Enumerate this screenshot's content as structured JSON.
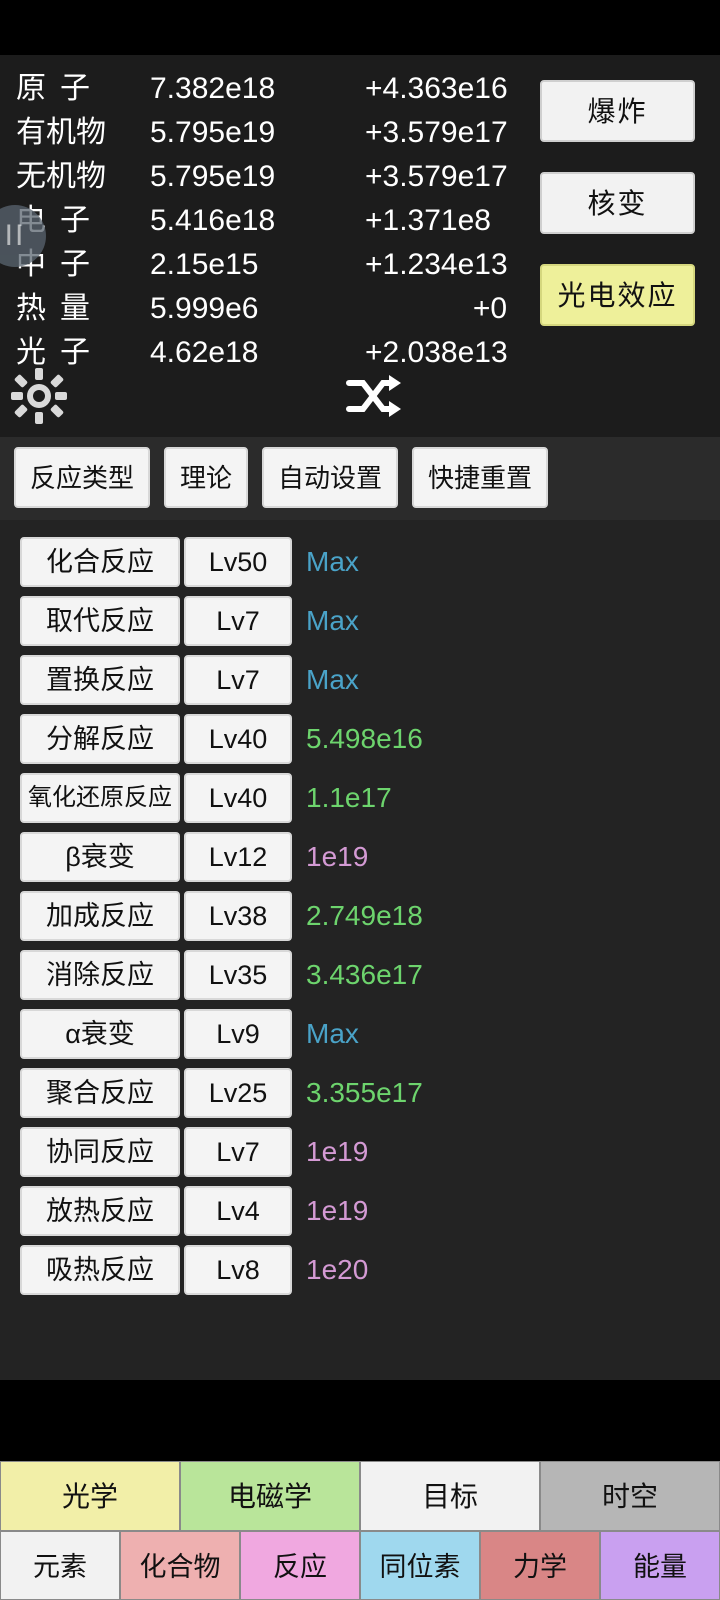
{
  "resources": {
    "rows": [
      {
        "name": "原子",
        "value": "7.382e18",
        "delta": "+4.363e16"
      },
      {
        "name": "有机物",
        "value": "5.795e19",
        "delta": "+3.579e17"
      },
      {
        "name": "无机物",
        "value": "5.795e19",
        "delta": "+3.579e17"
      },
      {
        "name": "电子",
        "value": "5.416e18",
        "delta": "+1.371e8"
      },
      {
        "name": "中子",
        "value": "2.15e15",
        "delta": "+1.234e13"
      },
      {
        "name": "热量",
        "value": "5.999e6",
        "delta": "+0"
      },
      {
        "name": "光子",
        "value": "4.62e18",
        "delta": "+2.038e13"
      }
    ],
    "side_buttons": [
      {
        "label": "爆炸",
        "style": "plain"
      },
      {
        "label": "核变",
        "style": "plain"
      },
      {
        "label": "光电效应",
        "style": "yellow"
      }
    ],
    "icons": {
      "pause": "pause-icon",
      "gear": "gear-icon",
      "shuffle": "shuffle-icon"
    }
  },
  "tabs": [
    {
      "label": "反应类型"
    },
    {
      "label": "理论"
    },
    {
      "label": "自动设置"
    },
    {
      "label": "快捷重置"
    }
  ],
  "reactions": [
    {
      "name": "化合反应",
      "level": "Lv50",
      "amount": "Max",
      "color": "#4aa3c8"
    },
    {
      "name": "取代反应",
      "level": "Lv7",
      "amount": "Max",
      "color": "#4aa3c8"
    },
    {
      "name": "置换反应",
      "level": "Lv7",
      "amount": "Max",
      "color": "#4aa3c8"
    },
    {
      "name": "分解反应",
      "level": "Lv40",
      "amount": "5.498e16",
      "color": "#6dd46d"
    },
    {
      "name": "氧化还原反应",
      "level": "Lv40",
      "amount": "1.1e17",
      "color": "#6dd46d"
    },
    {
      "name": "β衰变",
      "level": "Lv12",
      "amount": "1e19",
      "color": "#d49ad4"
    },
    {
      "name": "加成反应",
      "level": "Lv38",
      "amount": "2.749e18",
      "color": "#6dd46d"
    },
    {
      "name": "消除反应",
      "level": "Lv35",
      "amount": "3.436e17",
      "color": "#6dd46d"
    },
    {
      "name": "α衰变",
      "level": "Lv9",
      "amount": "Max",
      "color": "#4aa3c8"
    },
    {
      "name": "聚合反应",
      "level": "Lv25",
      "amount": "3.355e17",
      "color": "#6dd46d"
    },
    {
      "name": "协同反应",
      "level": "Lv7",
      "amount": "1e19",
      "color": "#d49ad4"
    },
    {
      "name": "放热反应",
      "level": "Lv4",
      "amount": "1e19",
      "color": "#d49ad4"
    },
    {
      "name": "吸热反应",
      "level": "Lv8",
      "amount": "1e20",
      "color": "#d49ad4"
    }
  ],
  "bottom_nav": {
    "top_row": [
      {
        "label": "光学",
        "bg": "#f2efa8"
      },
      {
        "label": "电磁学",
        "bg": "#b9e59a"
      },
      {
        "label": "目标",
        "bg": "#f2f2f2"
      },
      {
        "label": "时空",
        "bg": "#b6b6b6"
      }
    ],
    "bottom_row": [
      {
        "label": "元素",
        "bg": "#f2f2f2"
      },
      {
        "label": "化合物",
        "bg": "#eeb0b0"
      },
      {
        "label": "反应",
        "bg": "#f0a8e0"
      },
      {
        "label": "同位素",
        "bg": "#9fd8ee"
      },
      {
        "label": "力学",
        "bg": "#d98686"
      },
      {
        "label": "能量",
        "bg": "#c9a0f0"
      }
    ]
  }
}
